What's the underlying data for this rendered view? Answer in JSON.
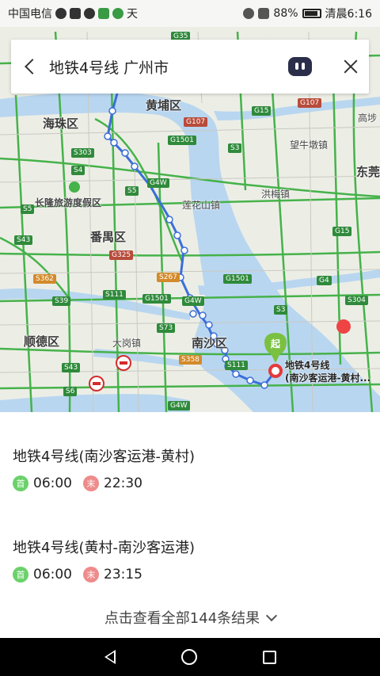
{
  "status_bar": {
    "carrier": "中国电信",
    "battery": "88%",
    "time": "清晨6:16",
    "weather": "天"
  },
  "search": {
    "query": "地铁4号线 广州市"
  },
  "map": {
    "labels": {
      "haizhu": "海珠区",
      "huangpu": "黄埔区",
      "panyu": "番禺区",
      "shunde": "顺德区",
      "nansha": "南沙区",
      "changlong": "长隆旅游度假区",
      "lianhuashan": "莲花山镇",
      "hongmei": "洪梅镇",
      "wangniudun": "望牛墩镇",
      "dagang": "大岗镇",
      "gaobu": "高埗",
      "dongguan": "东莞"
    },
    "marker_start": "起",
    "station_label_1": "地铁4号线",
    "station_label_2": "(南沙客运港-黄村..."
  },
  "results": [
    {
      "title": "地铁4号线(南沙客运港-黄村)",
      "first_badge": "首",
      "first_time": "06:00",
      "last_badge": "末",
      "last_time": "22:30"
    },
    {
      "title": "地铁4号线(黄村-南沙客运港)",
      "first_badge": "首",
      "first_time": "06:00",
      "last_badge": "末",
      "last_time": "23:15"
    }
  ],
  "more_results": "点击查看全部144条结果",
  "colors": {
    "route": "#3b6fd8",
    "water": "#b9d6f0",
    "road_green": "#46b24a",
    "marker_green": "#7ac142"
  }
}
